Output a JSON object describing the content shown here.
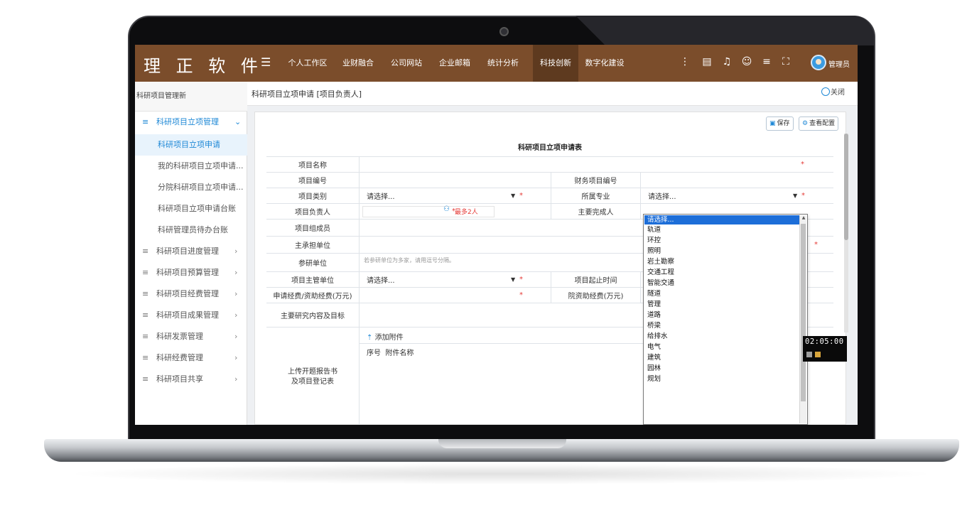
{
  "app": {
    "logo": "理 正 软 件",
    "user": "管理员"
  },
  "topnav": {
    "menu_icon": "☰",
    "tabs": [
      {
        "label": "个人工作区"
      },
      {
        "label": "业财融合"
      },
      {
        "label": "公司网站"
      },
      {
        "label": "企业邮箱"
      },
      {
        "label": "统计分析"
      },
      {
        "label": "科技创新",
        "active": true
      },
      {
        "label": "数字化建设"
      }
    ],
    "toolbar_icons": [
      "more-icon",
      "document-icon",
      "bell-icon",
      "user-icon",
      "list-icon",
      "fullscreen-icon"
    ]
  },
  "sidebar": {
    "title": "科研项目管理新",
    "groups": [
      {
        "label": "科研项目立项管理",
        "open": true,
        "children": [
          {
            "label": "科研项目立项申请",
            "active": true
          },
          {
            "label": "我的科研项目立项申请..."
          },
          {
            "label": "分院科研项目立项申请..."
          },
          {
            "label": "科研项目立项申请台账"
          },
          {
            "label": "科研管理员待办台账"
          }
        ]
      },
      {
        "label": "科研项目进度管理"
      },
      {
        "label": "科研项目预算管理"
      },
      {
        "label": "科研项目经费管理"
      },
      {
        "label": "科研项目成果管理"
      },
      {
        "label": "科研发票管理"
      },
      {
        "label": "科研经费管理"
      },
      {
        "label": "科研项目共享"
      }
    ]
  },
  "page": {
    "breadcrumb": "科研项目立项申请 [项目负责人]",
    "close_label": "关闭",
    "save_label": "保存",
    "view_config_label": "查看配置"
  },
  "form": {
    "title": "科研项目立项申请表",
    "labels": {
      "project_name": "项目名称",
      "project_no": "项目编号",
      "finance_no": "财务项目编号",
      "project_type": "项目类别",
      "major": "所属专业",
      "leader": "项目负责人",
      "main_finisher": "主要完成人",
      "members": "项目组成员",
      "host_unit": "主承担单位",
      "participants": "参研单位",
      "supervisor_unit": "项目主管单位",
      "period": "项目起止时间",
      "funding": "申请经费/资助经费(万元)",
      "institute_funding": "院资助经费(万元)",
      "research_content": "主要研究内容及目标",
      "upload": "上传开题报告书\n及项目登记表"
    },
    "select_placeholder": "请选择...",
    "leader_note": "最多2人",
    "participants_hint": "若参研单位为多家，请用逗号分隔。",
    "required_mark": "*",
    "add_attachment": "添加附件",
    "attach_col_no": "序号",
    "attach_col_name": "附件名称"
  },
  "major_dropdown": {
    "selected": "请选择...",
    "options": [
      "请选择...",
      "轨道",
      "环控",
      "照明",
      "岩土勘察",
      "交通工程",
      "智能交通",
      "隧道",
      "管理",
      "道路",
      "桥梁",
      "给排水",
      "电气",
      "建筑",
      "园林",
      "规划"
    ]
  },
  "timer": {
    "value": "02:05:00"
  }
}
